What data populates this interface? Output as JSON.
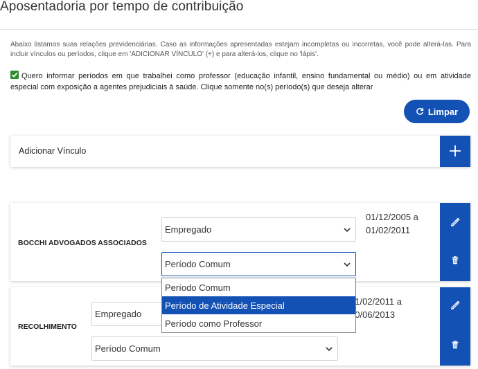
{
  "page": {
    "title": "Aposentadoria por tempo de contribuição",
    "intro": "Abaixo listamos suas relações previdenciárias. Caso as informações apresentadas estejam incompletas ou incorretas, você pode alterá-las. Para incluir vínculos ou períodos, clique em 'ADICIONAR VÍNCULO' (+) e para alterá-los, clique no 'lápis'.",
    "checkbox_label": "Quero informar períodos em que trabalhei como professor (educação infantil, ensino fundamental ou médio) ou em atividade especial com exposição a agentes prejudiciais à saúde. Clique somente no(s) período(s) que deseja alterar",
    "checkbox_checked": true,
    "clear_button": "Limpar",
    "add_link_label": "Adicionar Vínculo"
  },
  "links": [
    {
      "entity": "BOCCHI ADVOGADOS ASSOCIADOS",
      "type": "Empregado",
      "period_type": "Período Comum",
      "start": "01/12/2005 a",
      "end": "01/02/2011"
    },
    {
      "entity": "RECOLHIMENTO",
      "type": "Empregado",
      "period_type": "Período Comum",
      "start": "01/02/2011 a",
      "end": "30/06/2013"
    }
  ],
  "dropdown": {
    "options": [
      "Período Comum",
      "Período de Atividade Especial",
      "Período como Professor"
    ],
    "highlighted": "Período de Atividade Especial"
  },
  "colors": {
    "primary": "#1351b4",
    "check": "#2e8b2e"
  },
  "icons": {
    "clear": "refresh-icon",
    "add": "plus-icon",
    "edit": "pencil-icon",
    "delete": "trash-icon",
    "select": "chevron-down-icon"
  }
}
